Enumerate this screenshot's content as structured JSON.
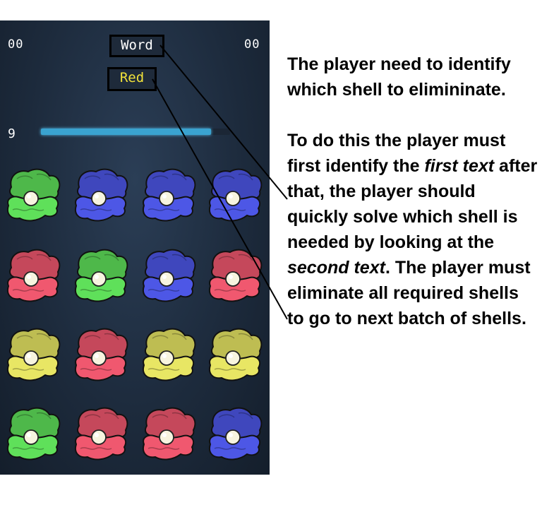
{
  "hud": {
    "score_left": "00",
    "score_right": "00",
    "first_text": "Word",
    "second_text": "Red",
    "timer_value": "9",
    "timer_fraction": 0.9
  },
  "colors": {
    "green": "#5fe05a",
    "blue": "#4d57e6",
    "red": "#f0586f",
    "yellow": "#e8e664",
    "second_text_color": "#f2e23a",
    "timer_bar": "#3aa3d0"
  },
  "shells": [
    [
      "green",
      "blue",
      "blue",
      "blue"
    ],
    [
      "red",
      "green",
      "blue",
      "red"
    ],
    [
      "yellow",
      "red",
      "yellow",
      "yellow"
    ],
    [
      "green",
      "red",
      "red",
      "blue"
    ]
  ],
  "instructions": {
    "p1": "The player need to identify which shell to elimininate.",
    "p2_a": "To do this the player must first identify the ",
    "p2_em1": "first text",
    "p2_b": " after that, the player should quickly solve which shell is needed by looking at the ",
    "p2_em2": "second text",
    "p2_c": ". The player must eliminate all required shells to go to next batch of shells."
  }
}
